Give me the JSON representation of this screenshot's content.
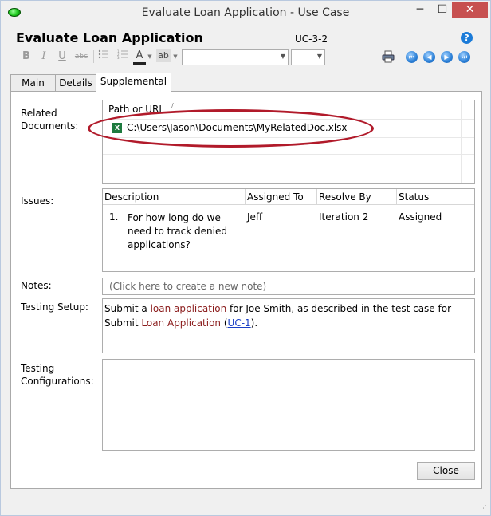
{
  "window": {
    "title": "Evaluate Loan Application - Use Case",
    "minimize": "─",
    "maximize": "☐",
    "close": "✕"
  },
  "header": {
    "title": "Evaluate Loan Application",
    "id": "UC-3-2",
    "help": "?"
  },
  "toolbar": {
    "bold": "B",
    "italic": "I",
    "underline": "U",
    "strike": "abc",
    "font_color": "A",
    "highlight": "ab",
    "font_value": "",
    "size_value": ""
  },
  "nav": {
    "first": "⏮",
    "prev": "◀",
    "next": "▶",
    "last": "⏭"
  },
  "tabs": [
    {
      "label": "Main"
    },
    {
      "label": "Details"
    },
    {
      "label": "Supplemental"
    }
  ],
  "related_documents": {
    "label": "Related Documents:",
    "column_header": "Path or URL",
    "rows": [
      {
        "path": "C:\\Users\\Jason\\Documents\\MyRelatedDoc.xlsx",
        "icon": "excel-icon"
      }
    ]
  },
  "issues": {
    "label": "Issues:",
    "columns": [
      "Description",
      "Assigned To",
      "Resolve By",
      "Status"
    ],
    "rows": [
      {
        "num": "1.",
        "description": "For how long do we need to track denied applications?",
        "assigned_to": "Jeff",
        "resolve_by": "Iteration 2",
        "status": "Assigned"
      }
    ]
  },
  "notes": {
    "label": "Notes:",
    "placeholder": "(Click here to create a new note)"
  },
  "testing_setup": {
    "label": "Testing Setup:",
    "text_1": "Submit a ",
    "link_1": "loan application",
    "text_2": " for Joe Smith, as described in the test case for Submit ",
    "link_2": "Loan Application",
    "text_3": " (",
    "link_3": "UC-1",
    "text_4": ")."
  },
  "testing_configurations": {
    "label": "Testing Configurations:",
    "value": ""
  },
  "footer": {
    "close_label": "Close"
  }
}
